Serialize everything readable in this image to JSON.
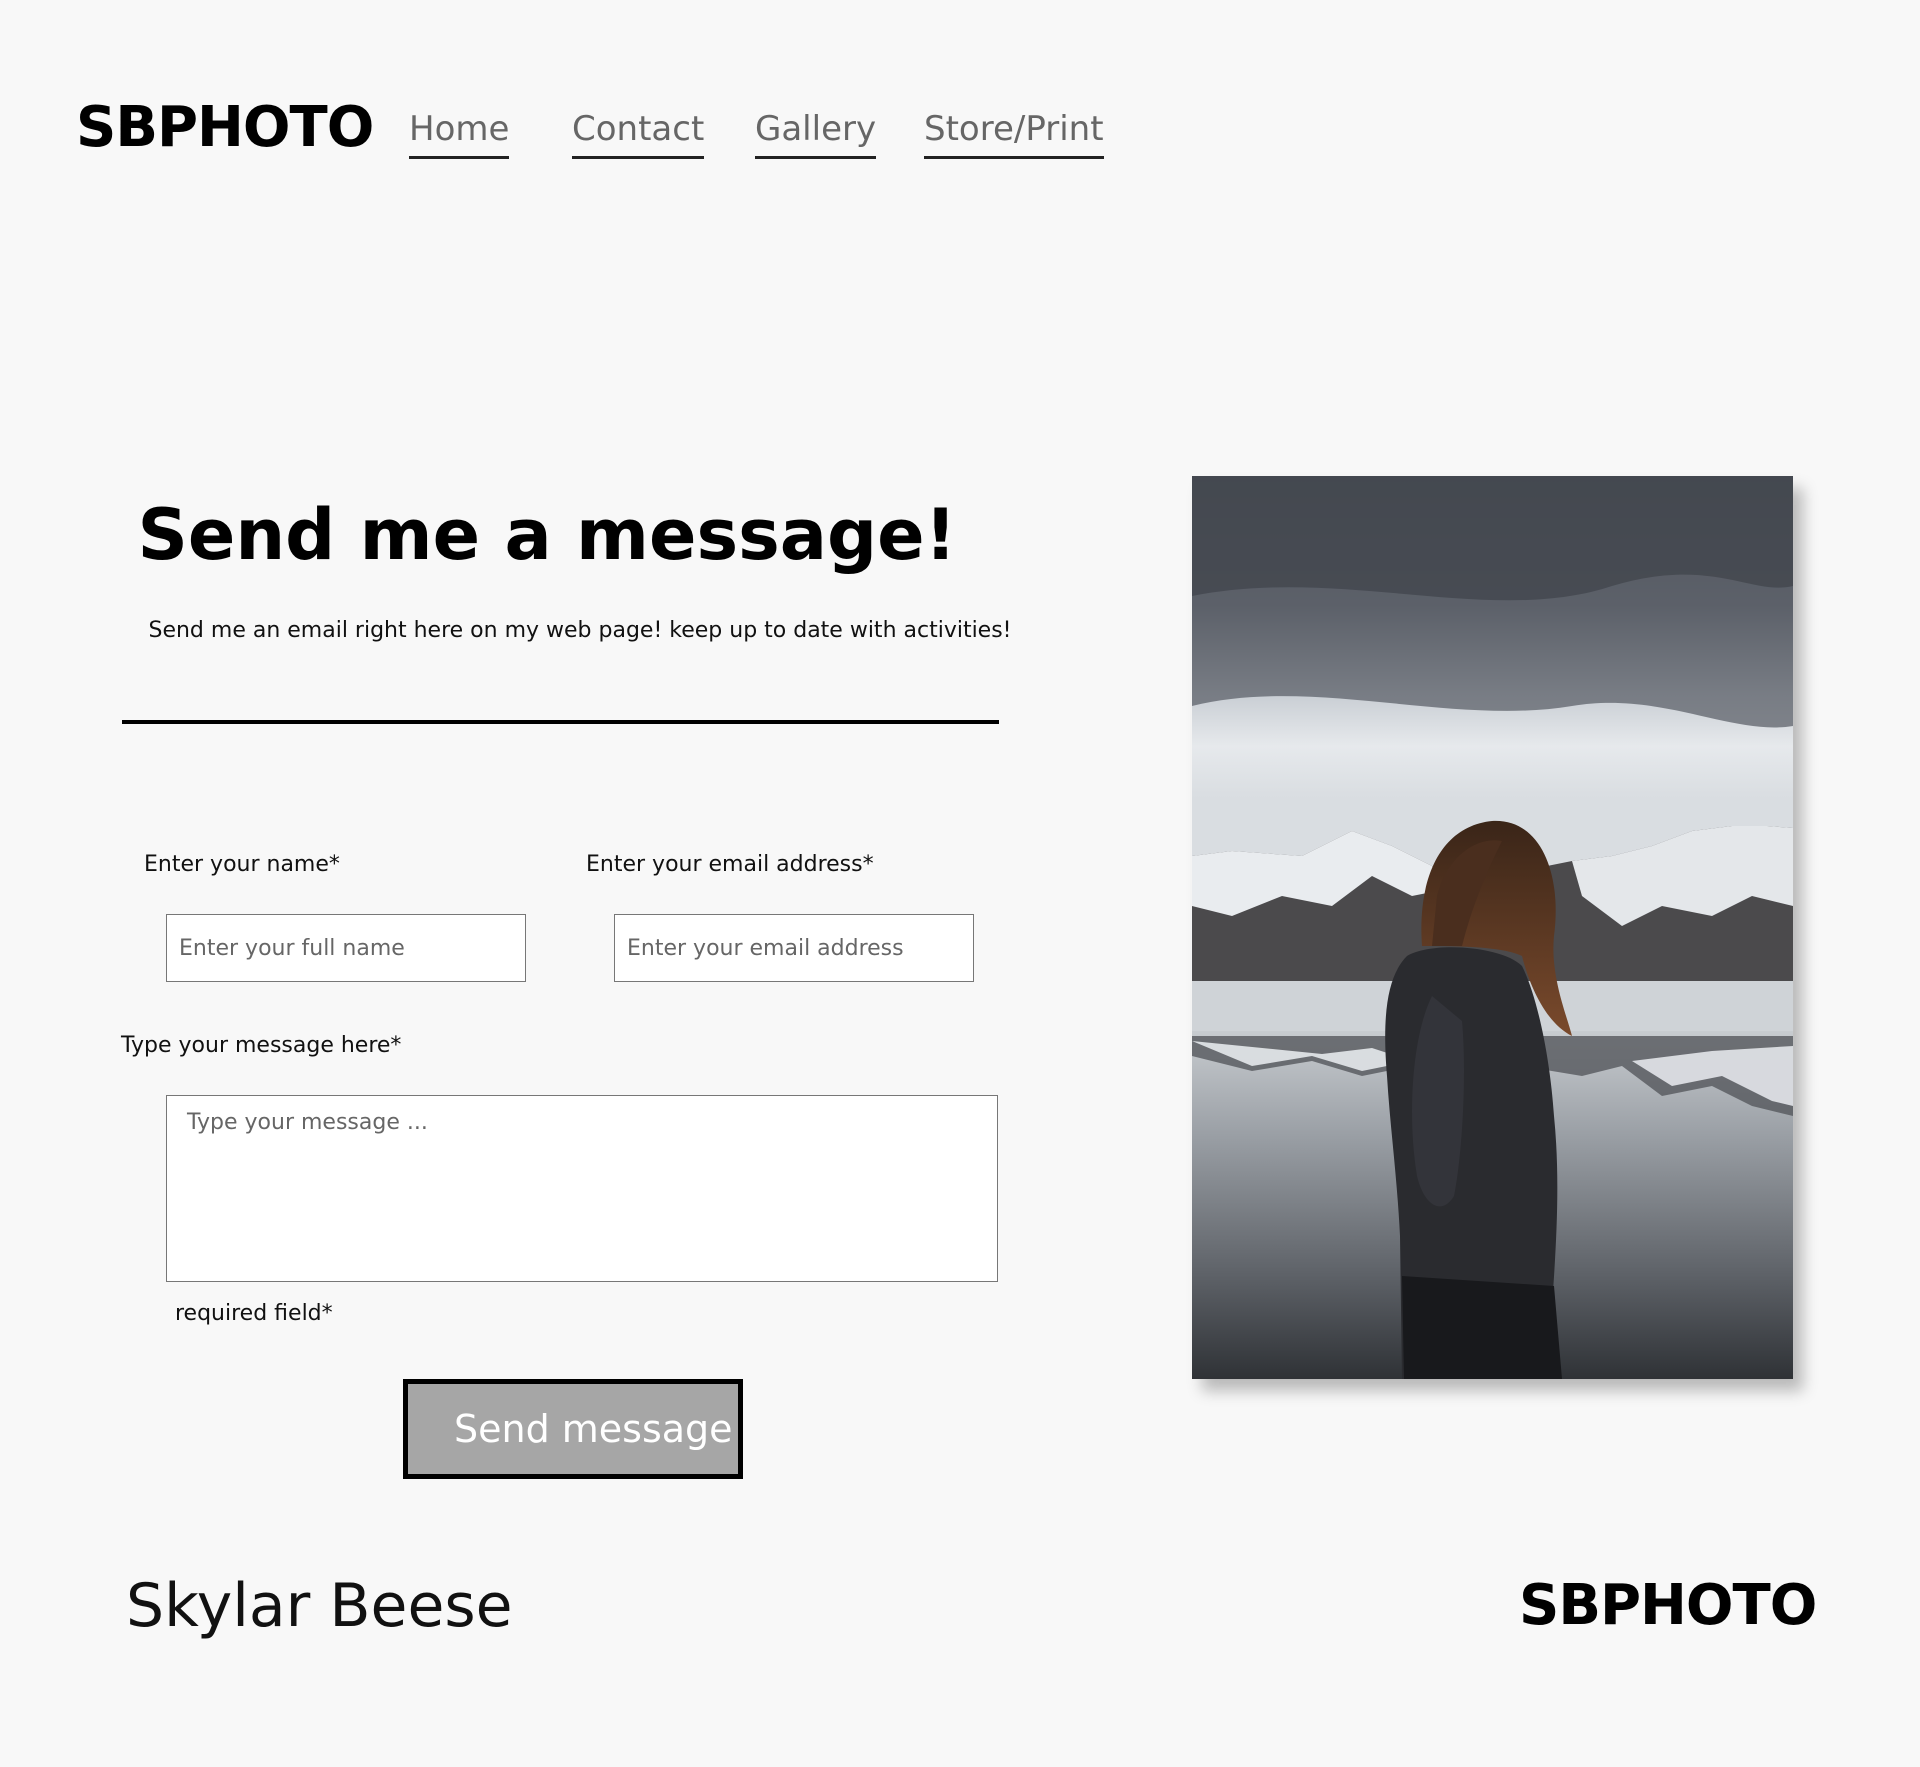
{
  "header": {
    "logo": "SBPHOTO",
    "nav": [
      "Home",
      "Contact",
      "Gallery",
      "Store/Print"
    ]
  },
  "main": {
    "title": "Send me a message!",
    "subtitle": "Send me an email right here on my web page! keep up to date with activities!"
  },
  "form": {
    "name_label": "Enter your name*",
    "name_placeholder": "Enter your full name",
    "email_label": "Enter your email address*",
    "email_placeholder": "Enter your email address",
    "message_label": "Type your message here*",
    "message_placeholder": "Type your message ...",
    "required_note": "required field*",
    "submit_label": "Send message"
  },
  "footer": {
    "name": "Skylar Beese",
    "logo": "SBPHOTO"
  },
  "colors": {
    "background": "#f8f8f8",
    "button": "#a6a6a6",
    "nav_text": "#666666"
  }
}
